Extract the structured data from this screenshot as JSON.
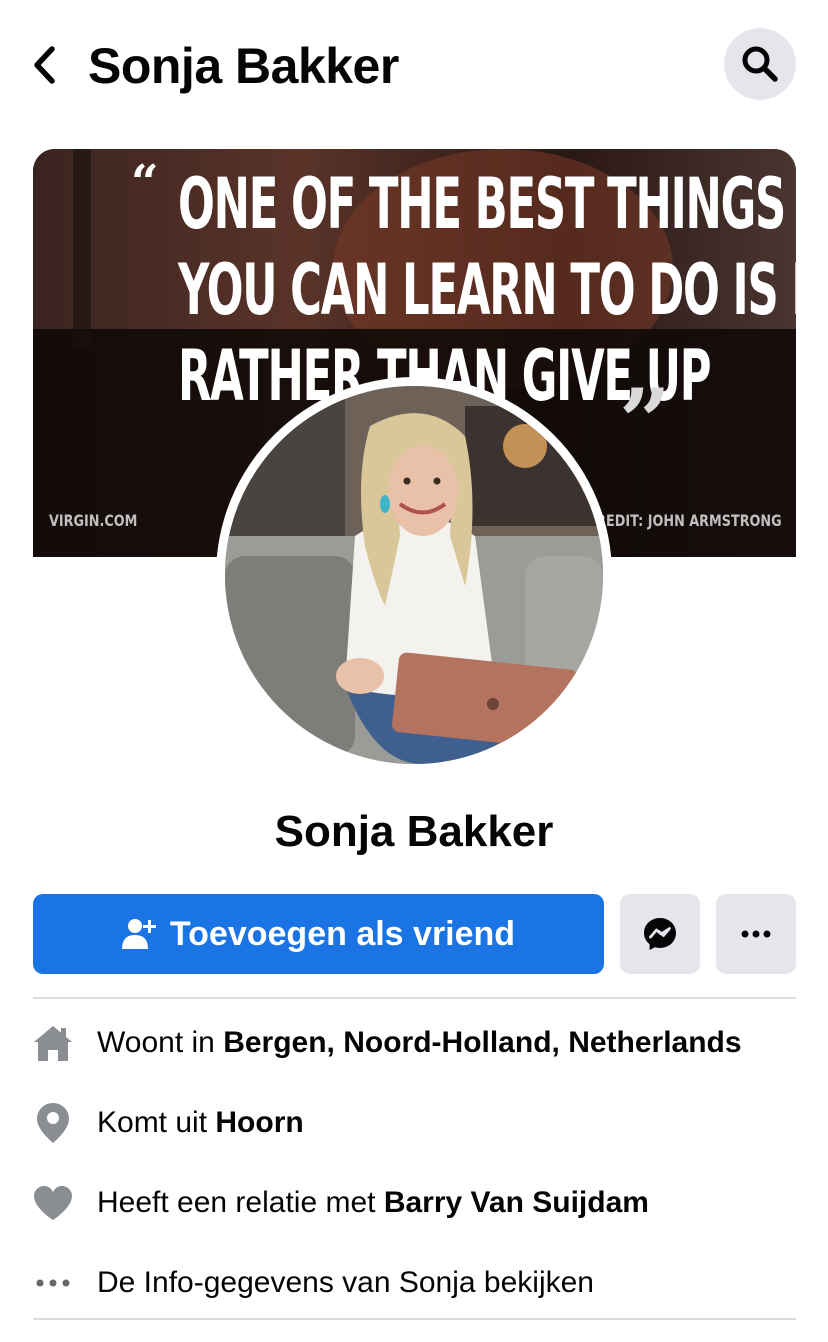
{
  "header": {
    "title": "Sonja Bakker",
    "back_icon": "chevron-left-icon",
    "search_icon": "search-icon"
  },
  "cover": {
    "quote_line1": "ONE OF THE BEST THINGS",
    "quote_line2": "YOU CAN LEARN TO DO IS REST,",
    "quote_line3": "RATHER THAN GIVE UP",
    "open_quote": "“",
    "close_quote": "”",
    "site": "VIRGIN.COM",
    "credit": "CREDIT: JOHN ARMSTRONG"
  },
  "profile": {
    "name": "Sonja Bakker"
  },
  "actions": {
    "add_friend_label": "Toevoegen als vriend",
    "add_friend_icon": "add-person-icon",
    "message_icon": "messenger-icon",
    "more_icon": "more-dots-icon"
  },
  "info": {
    "lives_prefix": "Woont in ",
    "lives_value": "Bergen, Noord-Holland, Netherlands",
    "from_prefix": "Komt uit ",
    "from_value": "Hoorn",
    "relationship_prefix": "Heeft een relatie met ",
    "relationship_value": "Barry Van Suijdam",
    "see_info": "De Info-gegevens van Sonja bekijken"
  },
  "colors": {
    "primary": "#1b74e4",
    "secondary_bg": "#e4e6eb",
    "icon_gray": "#8a8d91",
    "text": "#050505"
  }
}
